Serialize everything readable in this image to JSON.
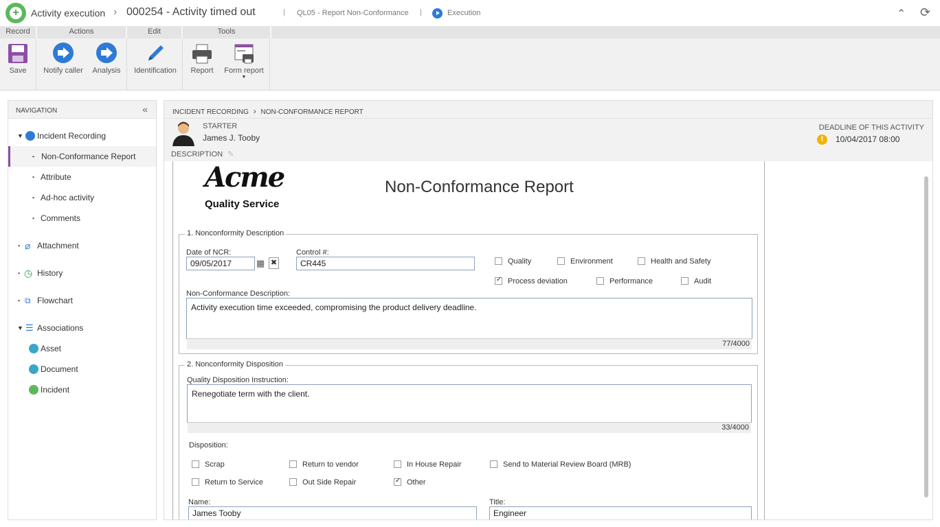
{
  "header": {
    "app": "Activity execution",
    "title": "000254 - Activity timed out",
    "process": "QL05 - Report Non-Conformance",
    "status": "Execution"
  },
  "toolbar": {
    "groups": [
      "Record",
      "Actions",
      "Edit",
      "Tools"
    ],
    "buttons": {
      "save": "Save",
      "notify": "Notify caller",
      "analysis": "Analysis",
      "identification": "Identification",
      "report": "Report",
      "form_report": "Form report"
    }
  },
  "nav": {
    "title": "NAVIGATION",
    "items": [
      {
        "label": "Incident Recording"
      },
      {
        "label": "Non-Conformance Report"
      },
      {
        "label": "Attribute"
      },
      {
        "label": "Ad-hoc activity"
      },
      {
        "label": "Comments"
      },
      {
        "label": "Attachment"
      },
      {
        "label": "History"
      },
      {
        "label": "Flowchart"
      },
      {
        "label": "Associations"
      },
      {
        "label": "Asset"
      },
      {
        "label": "Document"
      },
      {
        "label": "Incident"
      }
    ]
  },
  "breadcrumb": {
    "level1": "INCIDENT RECORDING",
    "level2": "NON-CONFORMANCE REPORT"
  },
  "starter": {
    "label": "STARTER",
    "name": "James J. Tooby"
  },
  "deadline": {
    "label": "DEADLINE OF THIS ACTIVITY",
    "value": "10/04/2017  08:00"
  },
  "description_label": "DESCRIPTION",
  "form": {
    "logo_main": "Acme",
    "logo_sub": "Quality Service",
    "title": "Non-Conformance Report",
    "section1": {
      "legend": "1. Nonconformity Description",
      "date_label": "Date of NCR:",
      "date_value": "09/05/2017",
      "control_label": "Control #:",
      "control_value": "CR445",
      "checks": [
        {
          "label": "Quality",
          "checked": false
        },
        {
          "label": "Environment",
          "checked": false
        },
        {
          "label": "Health and Safety",
          "checked": false
        },
        {
          "label": "Process deviation",
          "checked": true
        },
        {
          "label": "Performance",
          "checked": false
        },
        {
          "label": "Audit",
          "checked": false
        }
      ],
      "desc_label": "Non-Conformance Description:",
      "desc_value": "Activity execution time exceeded, compromising the product delivery deadline.",
      "desc_count": "77/4000"
    },
    "section2": {
      "legend": "2. Nonconformity Disposition",
      "instr_label": "Quality Disposition Instruction:",
      "instr_value": "Renegotiate term with the client.",
      "instr_count": "33/4000",
      "disp_label": "Disposition:",
      "checks": [
        {
          "label": "Scrap",
          "checked": false
        },
        {
          "label": "Return to vendor",
          "checked": false
        },
        {
          "label": "In House Repair",
          "checked": false
        },
        {
          "label": "Send to Material Review Board (MRB)",
          "checked": false
        },
        {
          "label": "Return to Service",
          "checked": false
        },
        {
          "label": "Out Side Repair",
          "checked": false
        },
        {
          "label": "Other",
          "checked": true
        }
      ],
      "name_label": "Name:",
      "name_value": "James Tooby",
      "title_label": "Title:",
      "title_value": "Engineer"
    }
  },
  "colors": {
    "accent": "#2e7bd6",
    "selected_bar": "#8e4ea7",
    "warning": "#f0b400"
  }
}
